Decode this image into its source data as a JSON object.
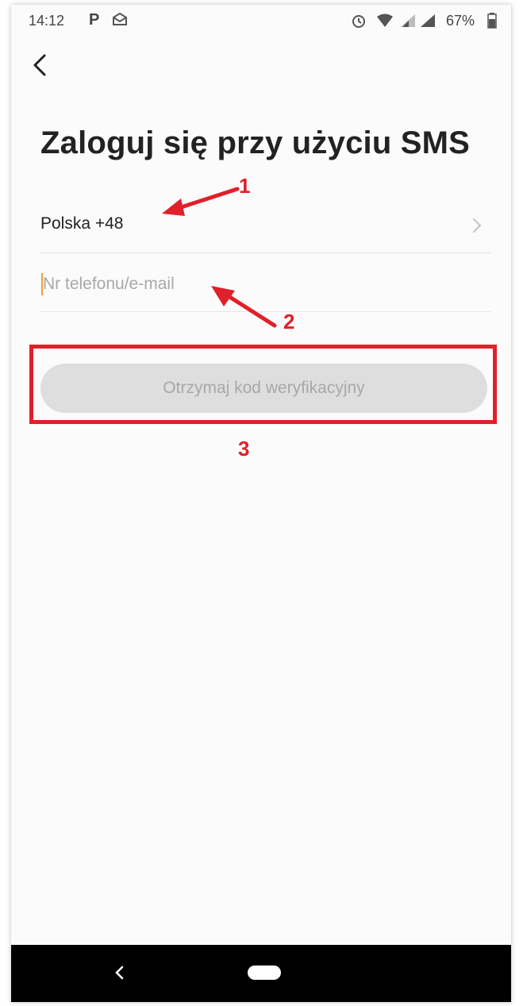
{
  "status_bar": {
    "time": "14:12",
    "p_icon": "P",
    "battery": "67%"
  },
  "page": {
    "title": "Zaloguj się przy użyciu SMS"
  },
  "country": {
    "label": "Polska +48"
  },
  "phone_input": {
    "value": "",
    "placeholder": "Nr telefonu/e-mail"
  },
  "verify_button": {
    "label": "Otrzymaj kod weryfikacyjny"
  },
  "annotations": {
    "one": "1",
    "two": "2",
    "three": "3"
  },
  "icons": {
    "back": "back-arrow-icon",
    "chevron": "chevron-right-icon",
    "nav_back": "nav-back-icon",
    "nav_home": "nav-home-pill"
  },
  "colors": {
    "annotation_red": "#e0202a",
    "button_bg": "#dedede",
    "button_text": "#a8a8a8",
    "caret": "#f0a030"
  }
}
